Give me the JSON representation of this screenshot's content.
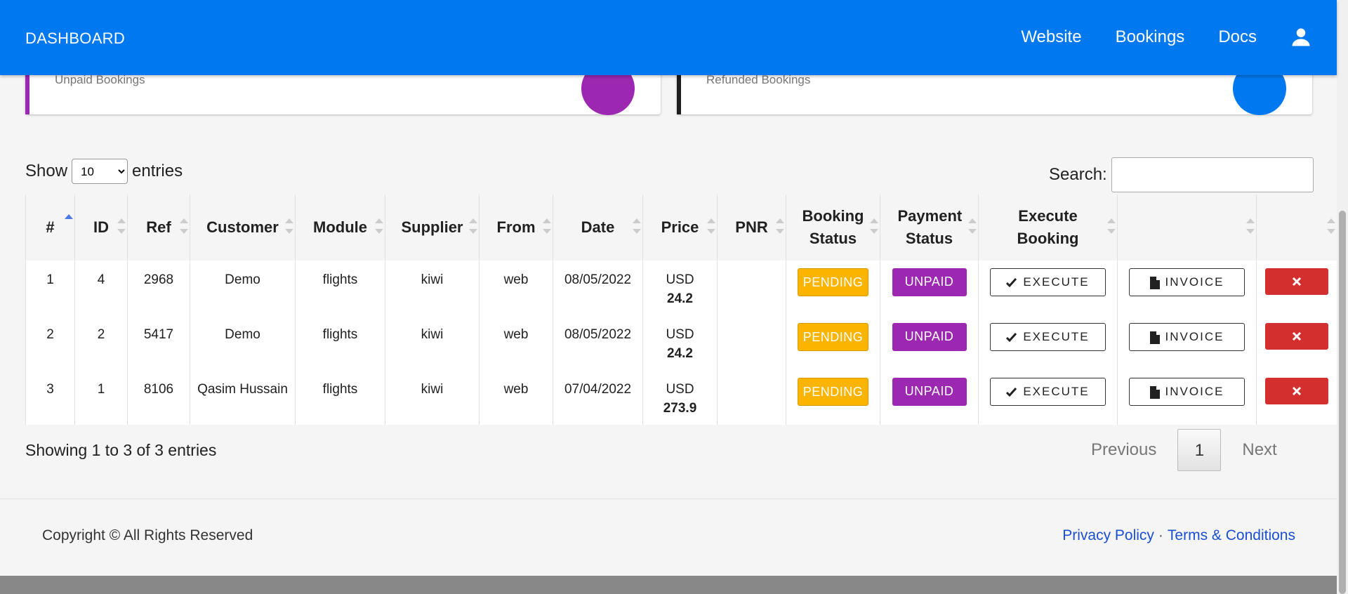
{
  "header": {
    "brand": "DASHBOARD",
    "nav": [
      "Website",
      "Bookings",
      "Docs"
    ],
    "user_icon": "user-icon"
  },
  "cards": [
    {
      "label": "Unpaid Bookings",
      "accent": "#9c27b0"
    },
    {
      "label": "Refunded Bookings",
      "accent": "#1e1e1e",
      "circle": "#0078f0"
    }
  ],
  "table_controls": {
    "show_label": "Show",
    "entries_label": "entries",
    "page_size": "10",
    "search_label": "Search:",
    "search_value": ""
  },
  "table": {
    "columns": [
      "#",
      "ID",
      "Ref",
      "Customer",
      "Module",
      "Supplier",
      "From",
      "Date",
      "Price",
      "PNR",
      "Booking Status",
      "Payment Status",
      "Execute Booking",
      "",
      ""
    ],
    "rows": [
      {
        "n": "1",
        "id": "4",
        "ref": "2968",
        "customer": "Demo",
        "module": "flights",
        "supplier": "kiwi",
        "from": "web",
        "date": "08/05/2022",
        "currency": "USD",
        "amount": "24.2",
        "pnr": "",
        "booking_status": "PENDING",
        "payment_status": "UNPAID",
        "execute": "EXECUTE",
        "invoice": "INVOICE"
      },
      {
        "n": "2",
        "id": "2",
        "ref": "5417",
        "customer": "Demo",
        "module": "flights",
        "supplier": "kiwi",
        "from": "web",
        "date": "08/05/2022",
        "currency": "USD",
        "amount": "24.2",
        "pnr": "",
        "booking_status": "PENDING",
        "payment_status": "UNPAID",
        "execute": "EXECUTE",
        "invoice": "INVOICE"
      },
      {
        "n": "3",
        "id": "1",
        "ref": "8106",
        "customer": "Qasim Hussain",
        "module": "flights",
        "supplier": "kiwi",
        "from": "web",
        "date": "07/04/2022",
        "currency": "USD",
        "amount": "273.9",
        "pnr": "",
        "booking_status": "PENDING",
        "payment_status": "UNPAID",
        "execute": "EXECUTE",
        "invoice": "INVOICE"
      }
    ]
  },
  "pagination": {
    "info": "Showing 1 to 3 of 3 entries",
    "previous": "Previous",
    "current": "1",
    "next": "Next"
  },
  "footer": {
    "copyright": "Copyright © All Rights Reserved",
    "privacy": "Privacy Policy",
    "separator": "·",
    "terms": "Terms & Conditions"
  },
  "colors": {
    "topbar": "#0078f0",
    "pending": "#fbb400",
    "unpaid": "#9c27b0",
    "delete": "#d32f2f"
  }
}
